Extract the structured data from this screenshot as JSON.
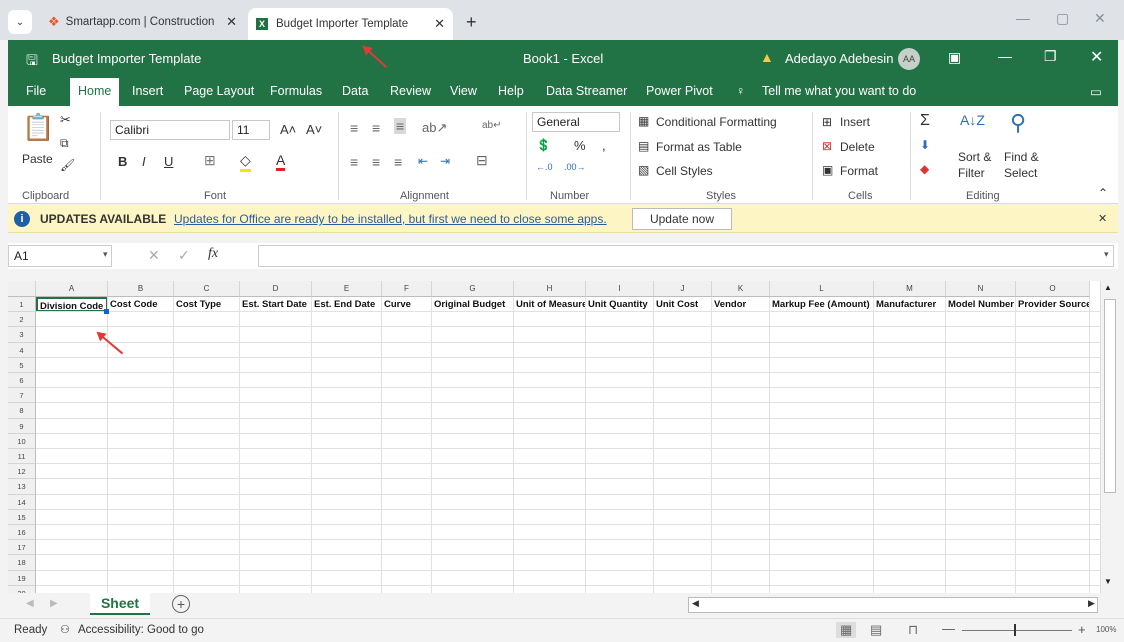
{
  "browser": {
    "tabs": [
      {
        "title": "Smartapp.com | Construction M",
        "active": false
      },
      {
        "title": "Budget Importer Template",
        "active": true
      }
    ],
    "new_tab": "+"
  },
  "excel": {
    "doc_title": "Budget Importer Template",
    "book_title": "Book1  -  Excel",
    "user_name": "Adedayo Adebesin",
    "user_initials": "AA",
    "menus": [
      "File",
      "Home",
      "Insert",
      "Page Layout",
      "Formulas",
      "Data",
      "Review",
      "View",
      "Help",
      "Data Streamer",
      "Power Pivot"
    ],
    "tell_me": "Tell me what you want to do",
    "ribbon": {
      "paste": "Paste",
      "font_name": "Calibri",
      "font_size": "11",
      "number_format": "General",
      "conditional_formatting": "Conditional Formatting",
      "format_as_table": "Format as Table",
      "cell_styles": "Cell Styles",
      "insert": "Insert",
      "delete": "Delete",
      "format": "Format",
      "sort_filter": "Sort &",
      "sort_filter2": "Filter",
      "find_select": "Find &",
      "find_select2": "Select",
      "groups": [
        "Clipboard",
        "Font",
        "Alignment",
        "Number",
        "Styles",
        "Cells",
        "Editing"
      ]
    },
    "update_bar": {
      "title": "UPDATES AVAILABLE",
      "message": "Updates for Office are ready to be installed, but first we need to close some apps.",
      "button": "Update now"
    },
    "name_box": "A1",
    "formula_label": "fx",
    "columns": [
      "A",
      "B",
      "C",
      "D",
      "E",
      "F",
      "G",
      "H",
      "I",
      "J",
      "K",
      "L",
      "M",
      "N",
      "O"
    ],
    "headers": [
      "Division Code",
      "Cost Code",
      "Cost Type",
      "Est. Start Date",
      "Est. End Date",
      "Curve",
      "Original Budget",
      "Unit of Measure",
      "Unit Quantity",
      "Unit Cost",
      "Vendor",
      "Markup Fee (Amount)",
      "Manufacturer",
      "Model Number",
      "Provider Source"
    ],
    "rows": [
      "1",
      "2",
      "3",
      "4",
      "5",
      "6",
      "7",
      "8",
      "9",
      "10",
      "11",
      "12",
      "13",
      "14",
      "15",
      "16",
      "17",
      "18",
      "19",
      "20"
    ],
    "sheet_tab": "Sheet",
    "status_ready": "Ready",
    "status_accessibility": "Accessibility: Good to go",
    "zoom": "100%"
  },
  "colors": {
    "excel_green": "#217346",
    "update_bg": "#fdf6c4",
    "arrow": "#e53935"
  }
}
